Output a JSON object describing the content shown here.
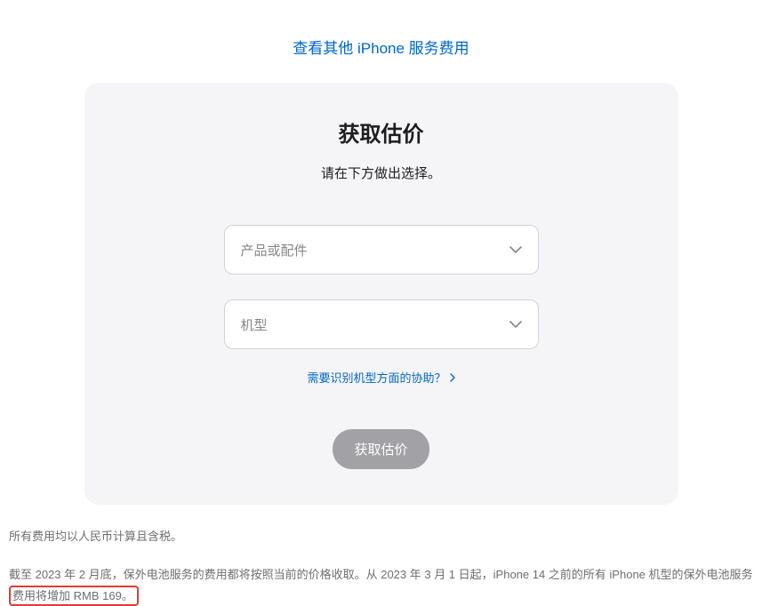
{
  "topLink": {
    "text": "查看其他 iPhone 服务费用"
  },
  "card": {
    "title": "获取估价",
    "subtitle": "请在下方做出选择。",
    "select1": {
      "placeholder": "产品或配件"
    },
    "select2": {
      "placeholder": "机型"
    },
    "helpLink": "需要识别机型方面的协助？",
    "submitLabel": "获取估价"
  },
  "footer": {
    "line1": "所有费用均以人民币计算且含税。",
    "line2_part1": "截至 2023 年 2 月底，保外电池服务的费用都将按照当前的价格收取。从 2023 年 3 月 1 日起，iPhone 14 之前的所有 iPhone 机型的保外电池服务",
    "line2_highlight": "费用将增加 RMB 169。"
  }
}
